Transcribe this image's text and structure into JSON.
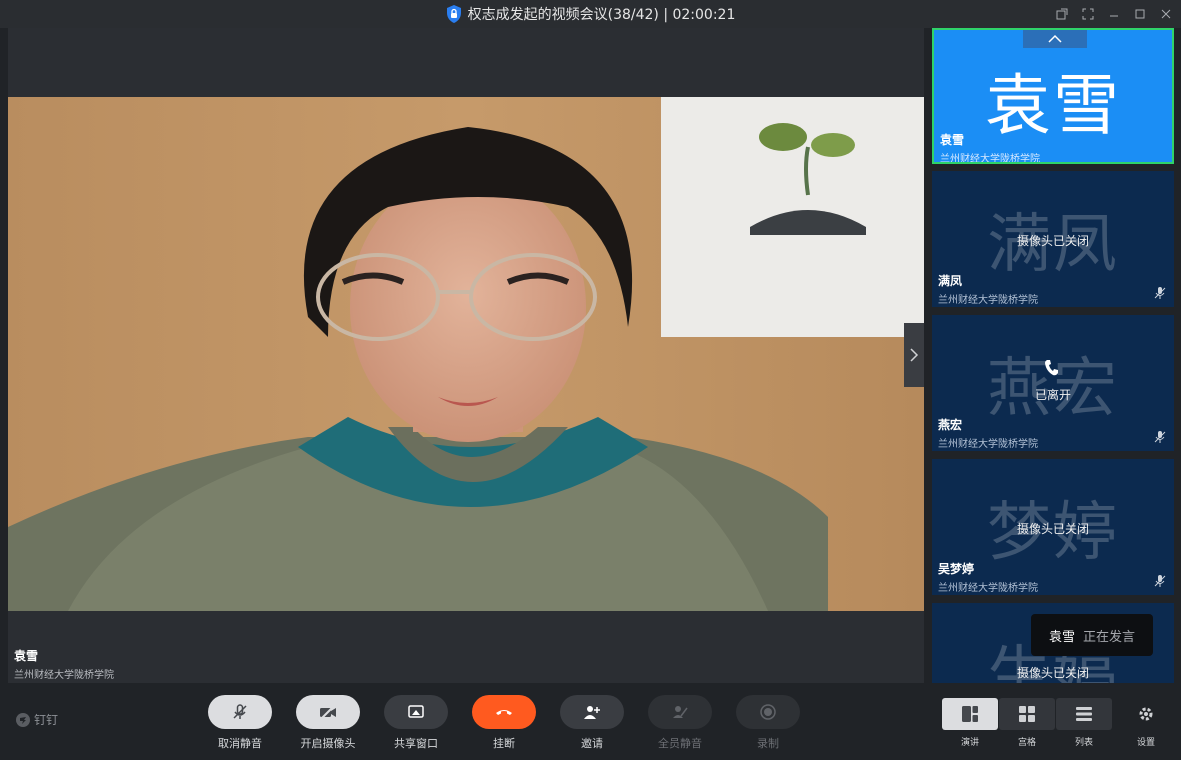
{
  "window": {
    "title": "权志成发起的视频会议(38/42) | 02:00:21"
  },
  "main_video": {
    "name": "袁雪",
    "org": "兰州财经大学陇桥学院"
  },
  "participants": [
    {
      "avatar": "袁雪",
      "name": "袁雪",
      "org": "兰州财经大学陇桥学院",
      "status": ""
    },
    {
      "avatar": "满凤",
      "name": "满凤",
      "org": "兰州财经大学陇桥学院",
      "status": "摄像头已关闭"
    },
    {
      "avatar": "燕宏",
      "name": "燕宏",
      "org": "兰州财经大学陇桥学院",
      "status": "已离开"
    },
    {
      "avatar": "梦婷",
      "name": "吴梦婷",
      "org": "兰州财经大学陇桥学院",
      "status": "摄像头已关闭"
    },
    {
      "avatar": "生婷",
      "name": "",
      "org": "",
      "status": "摄像头已关闭"
    }
  ],
  "speaking": {
    "name": "袁雪",
    "text": "正在发言"
  },
  "brand": "钉钉",
  "toolbar": {
    "unmute": "取消静音",
    "camera_on": "开启摄像头",
    "share": "共享窗口",
    "hangup": "挂断",
    "invite": "邀请",
    "mute_all": "全员静音",
    "record": "录制"
  },
  "views": {
    "speaker": "演讲",
    "grid": "宫格",
    "list": "列表",
    "settings": "设置"
  },
  "colors": {
    "accent_blue": "#1b8ef5",
    "active_border": "#2fd36a",
    "hangup_red": "#ff5a1f",
    "tile_bg": "#0c2a4f"
  }
}
